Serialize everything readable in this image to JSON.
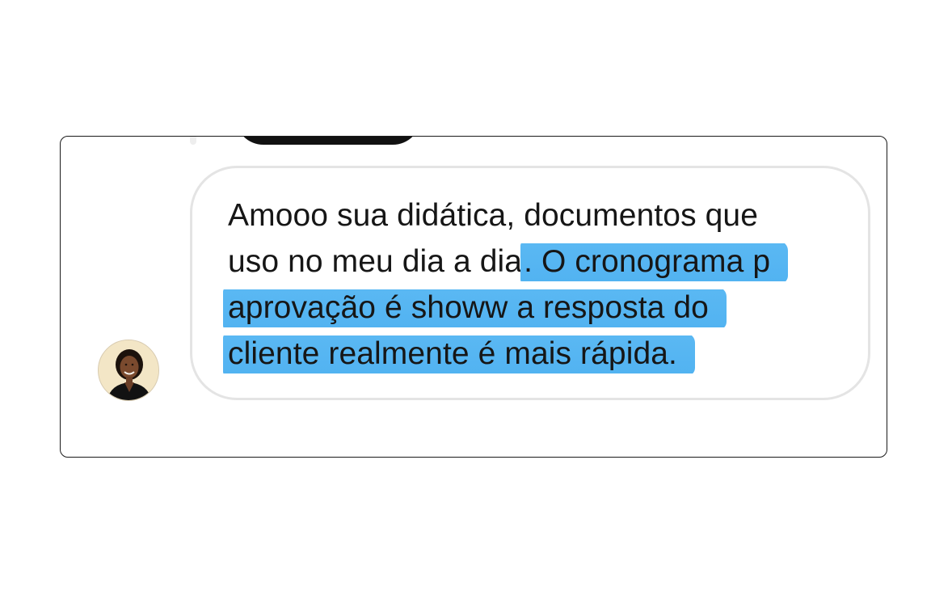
{
  "conversation": {
    "previous_message": "",
    "message": {
      "plain_text": "Amooo sua didática, documentos que uso no meu dia a dia",
      "lines": [
        {
          "plain": "Amooo sua didática, documentos que",
          "highlighted": ""
        },
        {
          "plain": "uso no meu dia a dia",
          "highlighted": ". O cronograma p"
        },
        {
          "plain": "",
          "highlighted": "aprovação é  showw a resposta do"
        },
        {
          "plain": "",
          "highlighted": "cliente realmente é  mais rápida."
        }
      ],
      "highlighted_text": ". O cronograma p aprovação é  showw a resposta do cliente realmente é  mais rápida."
    },
    "sender": {
      "avatar_icon": "profile-photo"
    }
  },
  "colors": {
    "highlight": "#52b3f1",
    "bubble_border": "#e4e4e4",
    "text": "#161616",
    "frame_border": "#1a1a1a"
  }
}
